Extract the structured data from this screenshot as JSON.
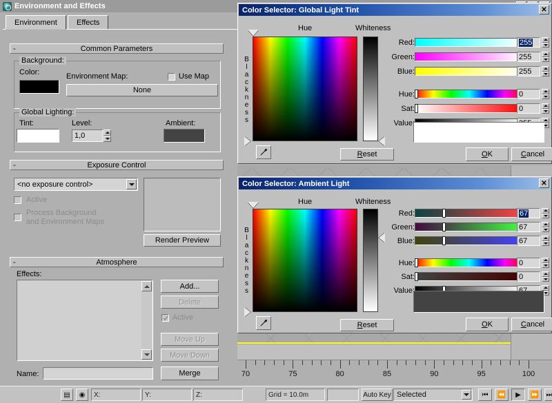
{
  "app": {
    "background_panels": {
      "timeline_labels": [
        "70",
        "75",
        "80",
        "85",
        "90",
        "95",
        "100"
      ],
      "grid_text": "Grid = 10.0m",
      "autokey_label": "Auto Key",
      "selection_filter": "Selected",
      "axis_x": "X:",
      "axis_y": "Y:",
      "axis_z": "Z:",
      "nav_icons": [
        "skip-start-icon",
        "step-back-icon",
        "play-icon",
        "step-forward-icon",
        "skip-end-icon"
      ]
    }
  },
  "env_window": {
    "title": "Environment and Effects",
    "app_icon": "max-teapot-icon",
    "titlebar_buttons": [
      {
        "name": "minimize-button",
        "glyph": "_"
      },
      {
        "name": "maximize-button",
        "glyph": "❐"
      },
      {
        "name": "close-button",
        "glyph": "✕"
      }
    ],
    "tabs": [
      {
        "label": "Environment",
        "selected": true
      },
      {
        "label": "Effects",
        "selected": false
      }
    ],
    "rollouts": {
      "common": {
        "header": "Common Parameters",
        "collapse_glyph": "-",
        "background_group": "Background:",
        "color_label": "Color:",
        "color_value": "#000000",
        "env_map_label": "Environment Map:",
        "use_map_label": "Use Map",
        "use_map_checked": false,
        "map_button": "None",
        "global_lighting_group": "Global Lighting:",
        "tint_label": "Tint:",
        "tint_value": "#ffffff",
        "level_label": "Level:",
        "level_value": "1,0",
        "ambient_label": "Ambient:",
        "ambient_value": "#434343"
      },
      "exposure": {
        "header": "Exposure Control",
        "collapse_glyph": "-",
        "dropdown_value": "<no exposure control>",
        "active_label": "Active",
        "active_checked": false,
        "process_label_line1": "Process Background",
        "process_label_line2": "and Environment Maps",
        "process_checked": false,
        "render_preview_button": "Render Preview"
      },
      "atmosphere": {
        "header": "Atmosphere",
        "collapse_glyph": "-",
        "effects_label": "Effects:",
        "effects_items": [],
        "add_button": "Add...",
        "delete_button": "Delete",
        "active_label": "Active",
        "active_checked": true,
        "move_up_button": "Move Up",
        "move_down_button": "Move Down",
        "name_label": "Name:",
        "name_value": "",
        "merge_button": "Merge"
      }
    }
  },
  "color_selector_1": {
    "title": "Color Selector: Global Light Tint",
    "close_glyph": "✕",
    "hue_label": "Hue",
    "whiteness_label": "Whiteness",
    "blackness_label": "Blackness",
    "reset_button": "Reset",
    "ok_button": "OK",
    "cancel_button": "Cancel",
    "eyedropper_icon": "eyedropper-icon",
    "preview_color": "#ffffff",
    "hue_marker_pct": 0,
    "blackness_marker_pct": 100,
    "whiteness_marker_pct": 100,
    "channels": [
      {
        "name": "Red:",
        "value": "255",
        "selected": true,
        "gradient": "linear-gradient(90deg,#00ffff 0%,#ffffff 100%)",
        "knob_pct": 99
      },
      {
        "name": "Green:",
        "value": "255",
        "selected": false,
        "gradient": "linear-gradient(90deg,#ff00ff 0%,#ffffff 100%)",
        "knob_pct": 99
      },
      {
        "name": "Blue:",
        "value": "255",
        "selected": false,
        "gradient": "linear-gradient(90deg,#ffff00 0%,#ffffff 100%)",
        "knob_pct": 99
      }
    ],
    "hsv": [
      {
        "name": "Hue:",
        "value": "0",
        "knob_pct": 0,
        "gradient": "linear-gradient(90deg,#ff0000 0%,#ffff00 16.6%,#00ff00 33.3%,#00ffff 50%,#0000ff 66.6%,#ff00ff 83.3%,#ff0000 100%)"
      },
      {
        "name": "Sat:",
        "value": "0",
        "knob_pct": 0,
        "gradient": "linear-gradient(90deg,#ffffff 0%,#ff0000 100%)"
      },
      {
        "name": "Value:",
        "value": "255",
        "knob_pct": 99,
        "gradient": "linear-gradient(90deg,#000000 0%,#ffffff 100%)"
      }
    ]
  },
  "color_selector_2": {
    "title": "Color Selector: Ambient Light",
    "close_glyph": "✕",
    "hue_label": "Hue",
    "whiteness_label": "Whiteness",
    "blackness_label": "Blackness",
    "reset_button": "Reset",
    "ok_button": "OK",
    "cancel_button": "Cancel",
    "eyedropper_icon": "eyedropper-icon",
    "preview_color": "#434343",
    "hue_marker_pct": 0,
    "blackness_marker_pct": 100,
    "whiteness_marker_pct": 26,
    "channels": [
      {
        "name": "Red:",
        "value": "67",
        "selected": true,
        "gradient": "linear-gradient(90deg,#0c4343 0%,#434343 26%,#ff4343 100%)",
        "knob_pct": 26
      },
      {
        "name": "Green:",
        "value": "67",
        "selected": false,
        "gradient": "linear-gradient(90deg,#430c43 0%,#434343 26%,#43ff43 100%)",
        "knob_pct": 26
      },
      {
        "name": "Blue:",
        "value": "67",
        "selected": false,
        "gradient": "linear-gradient(90deg,#43430c 0%,#434343 26%,#4343ff 100%)",
        "knob_pct": 26
      }
    ],
    "hsv": [
      {
        "name": "Hue:",
        "value": "0",
        "knob_pct": 0,
        "gradient": "linear-gradient(90deg,#ff0000 0%,#ffff00 16.6%,#00ff00 33.3%,#00ffff 50%,#0000ff 66.6%,#ff00ff 83.3%,#ff0000 100%)"
      },
      {
        "name": "Sat:",
        "value": "0",
        "knob_pct": 0,
        "gradient": "linear-gradient(90deg,#434343 0%,#430000 100%)"
      },
      {
        "name": "Value:",
        "value": "67",
        "knob_pct": 26,
        "gradient": "linear-gradient(90deg,#000000 0%,#ffffff 100%)"
      }
    ]
  }
}
